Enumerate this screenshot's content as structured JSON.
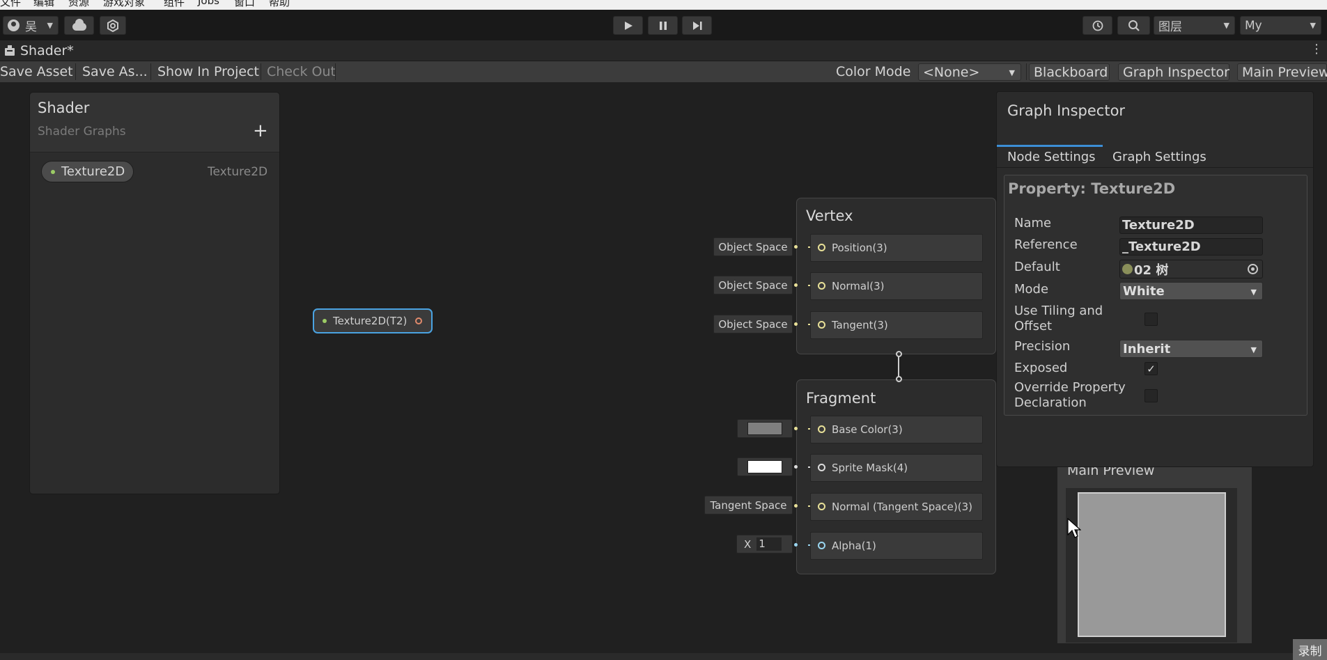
{
  "menubar": {
    "items": [
      "文件",
      "编辑",
      "资源",
      "游戏对象",
      "组件",
      "Jobs",
      "窗口",
      "帮助"
    ]
  },
  "toolbar": {
    "account_label": "吴",
    "layers_label": "图层",
    "layout_label": "My",
    "icons": [
      "account-icon",
      "cloud-icon",
      "collab-icon",
      "play-icon",
      "pause-icon",
      "step-icon",
      "history-icon",
      "search-icon"
    ]
  },
  "tab": {
    "title": "Shader*"
  },
  "graph_toolbar": {
    "save_asset": "Save Asset",
    "save_as": "Save As...",
    "show_in_project": "Show In Project",
    "check_out": "Check Out",
    "color_mode_label": "Color Mode",
    "color_mode_value": "<None>",
    "blackboard": "Blackboard",
    "graph_inspector": "Graph Inspector",
    "main_preview": "Main Preview"
  },
  "blackboard": {
    "title": "Shader",
    "subtitle": "Shader Graphs",
    "add": "+",
    "property": {
      "name": "Texture2D",
      "type": "Texture2D"
    }
  },
  "texture_node": {
    "label": "Texture2D(T2)"
  },
  "vertex": {
    "title": "Vertex",
    "blocks": [
      {
        "label": "Position(3)",
        "input": "Object Space"
      },
      {
        "label": "Normal(3)",
        "input": "Object Space"
      },
      {
        "label": "Tangent(3)",
        "input": "Object Space"
      }
    ]
  },
  "fragment": {
    "title": "Fragment",
    "blocks": [
      {
        "label": "Base Color(3)",
        "input_color": "#7f7f7f"
      },
      {
        "label": "Sprite Mask(4)",
        "input_color": "#ffffff"
      },
      {
        "label": "Normal (Tangent Space)(3)",
        "input": "Tangent Space"
      },
      {
        "label": "Alpha(1)",
        "input_axis": "X",
        "input_value": "1"
      }
    ]
  },
  "inspector": {
    "title": "Graph Inspector",
    "tabs": [
      "Node Settings",
      "Graph Settings"
    ],
    "property_title": "Property: Texture2D",
    "fields": {
      "name_label": "Name",
      "name_value": "Texture2D",
      "reference_label": "Reference",
      "reference_value": "_Texture2D",
      "default_label": "Default",
      "default_value": "02 树",
      "mode_label": "Mode",
      "mode_value": "White",
      "tiling_label_1": "Use Tiling and",
      "tiling_label_2": "Offset",
      "precision_label": "Precision",
      "precision_value": "Inherit",
      "exposed_label": "Exposed",
      "exposed_check": "✓",
      "override_label_1": "Override Property",
      "override_label_2": "Declaration"
    }
  },
  "preview": {
    "title": "Main Preview"
  },
  "status": {
    "rec_label": "录制"
  }
}
